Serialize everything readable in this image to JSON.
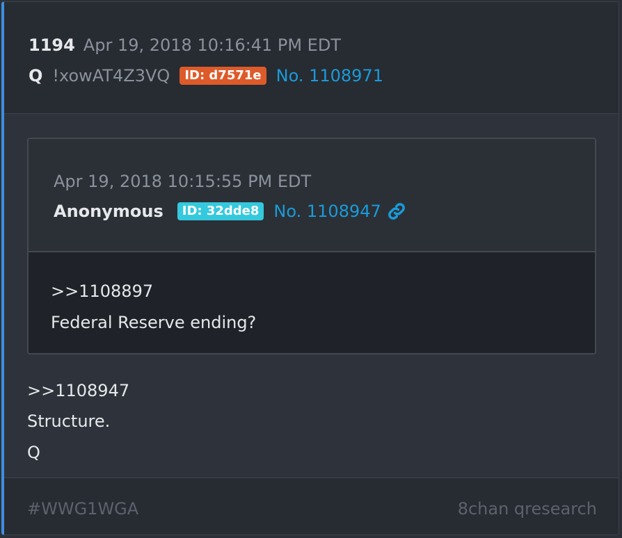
{
  "post": {
    "number": "1194",
    "timestamp": "Apr 19, 2018 10:16:41 PM EDT",
    "author": "Q",
    "tripcode": "!xowAT4Z3VQ",
    "id_badge": "ID: d7571e",
    "post_no": "No. 1108971",
    "id_badge_color": "#dd5b2a"
  },
  "quoted": {
    "timestamp": "Apr 19, 2018 10:15:55 PM EDT",
    "author": "Anonymous",
    "id_badge": "ID: 32dde8",
    "post_no": "No. 1108947",
    "id_badge_color": "#35c9dd",
    "link_icon": "link-icon",
    "lines": [
      ">>1108897",
      "Federal Reserve ending?"
    ]
  },
  "body": {
    "lines": [
      ">>1108947",
      "Structure.",
      "Q"
    ]
  },
  "footer": {
    "hashtag": "#WWG1WGA",
    "source": "8chan qresearch"
  }
}
